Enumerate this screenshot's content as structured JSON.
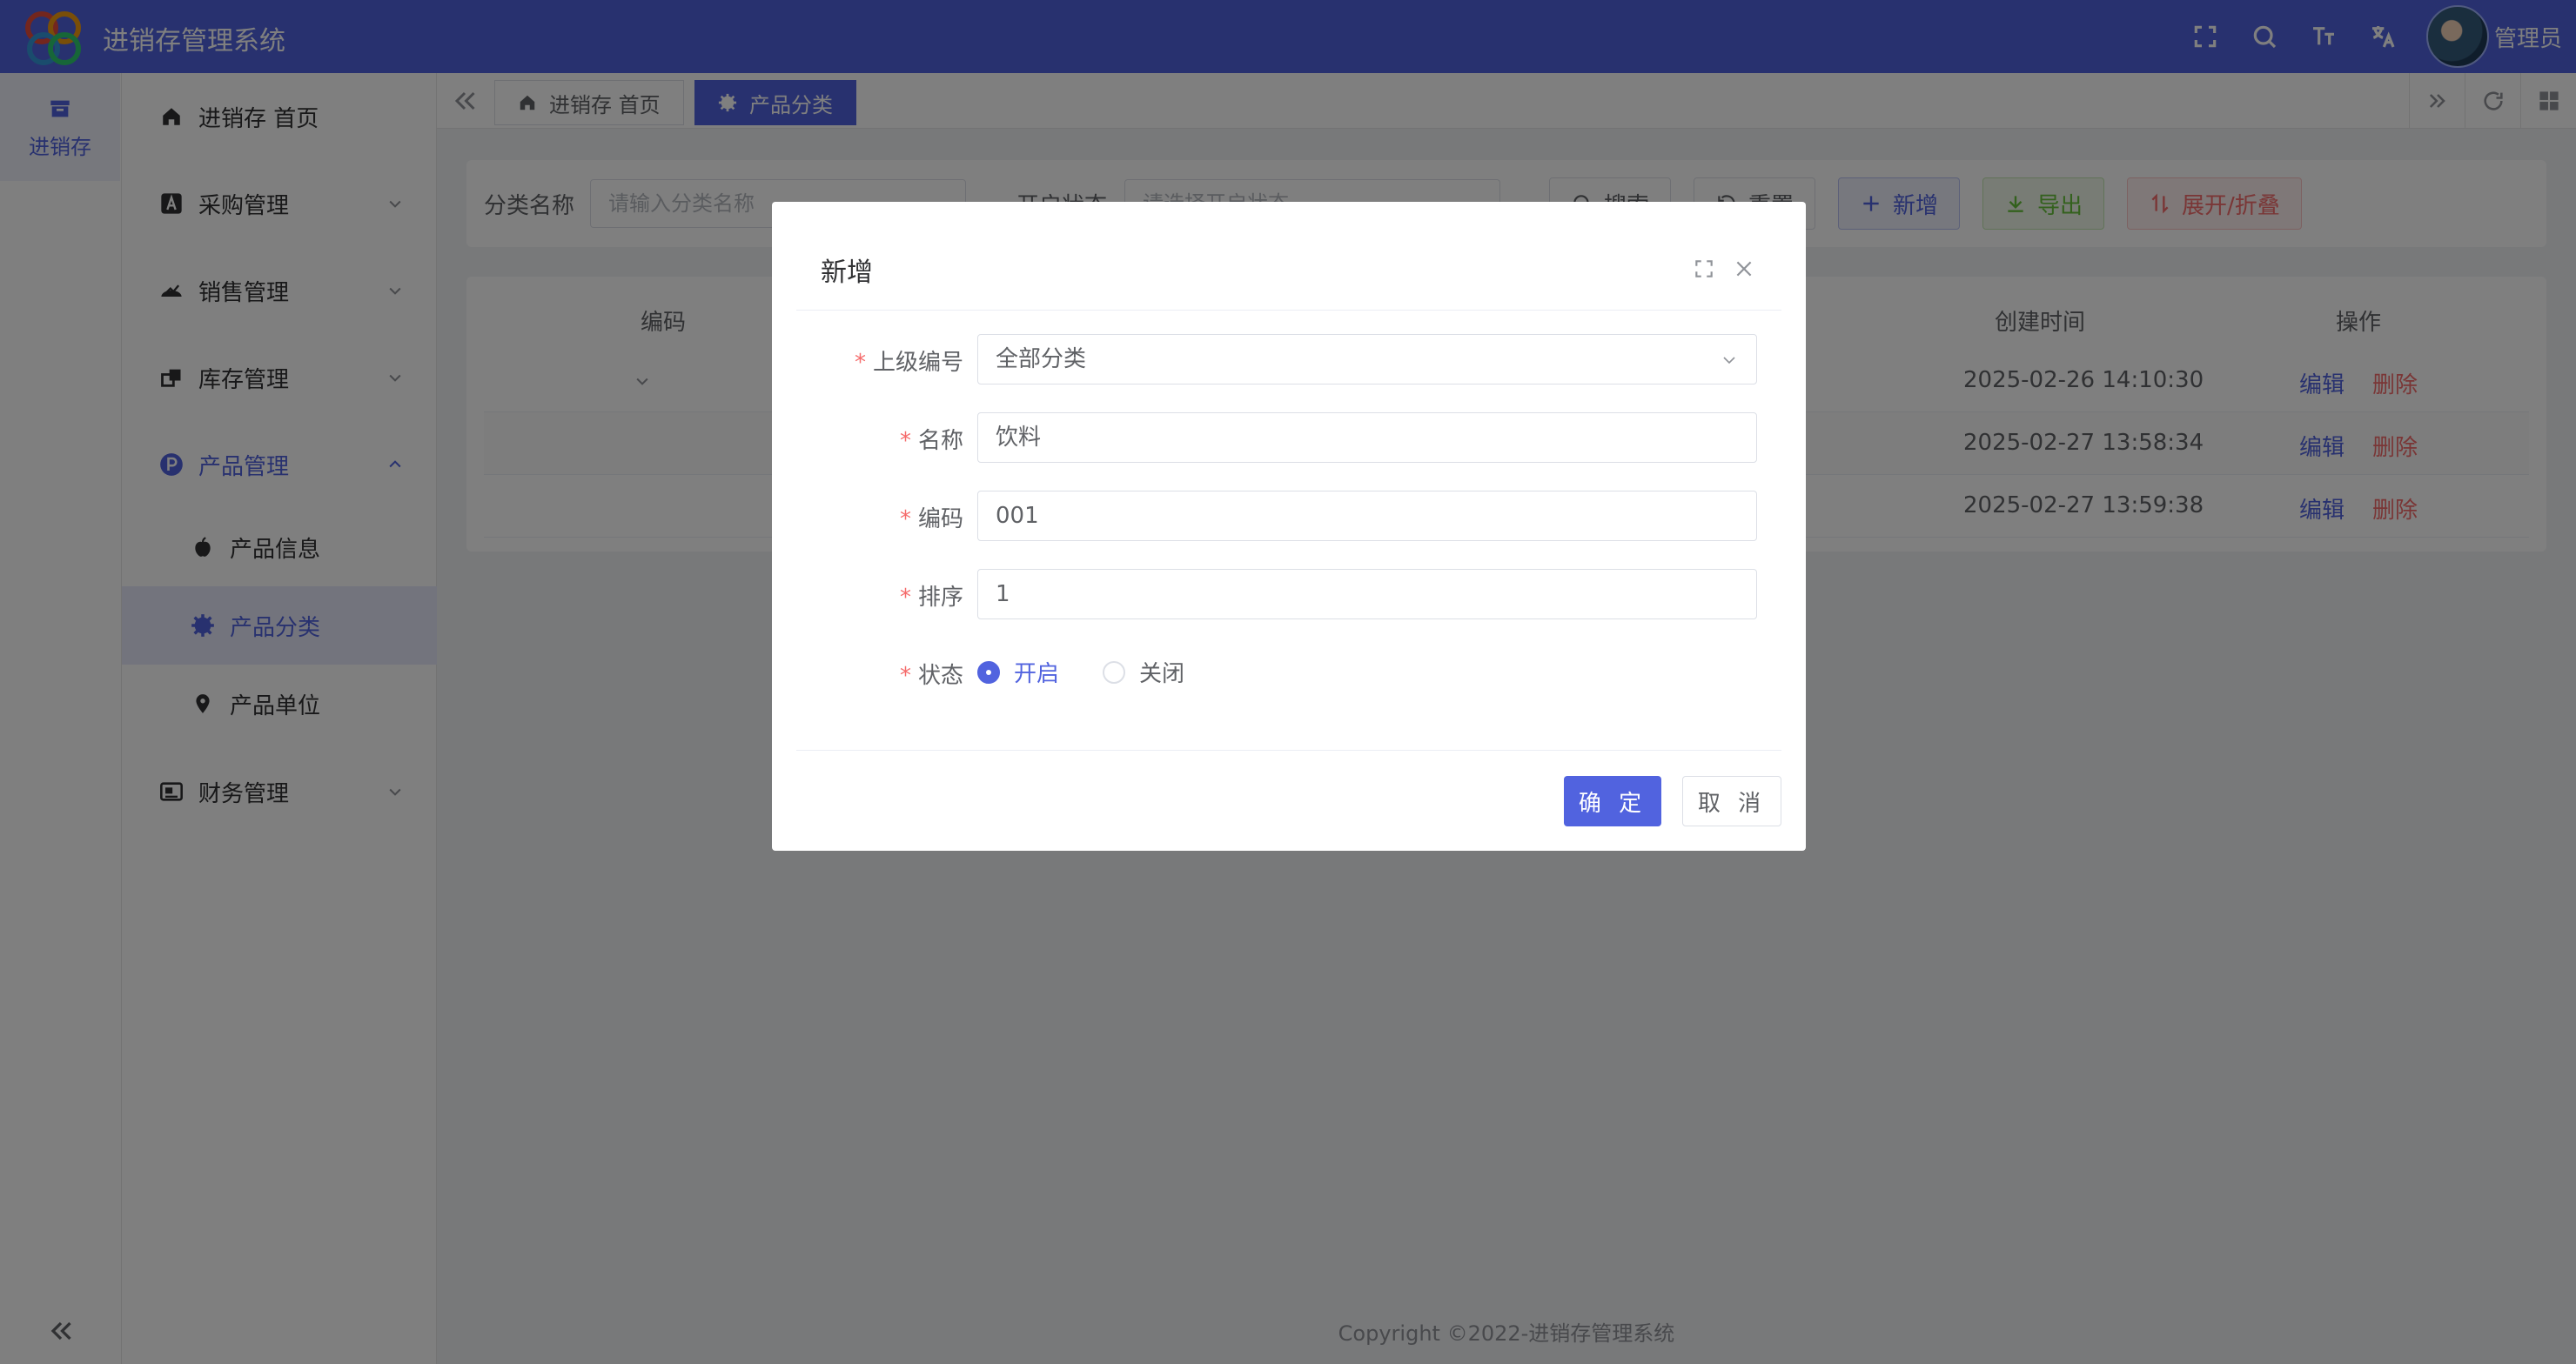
{
  "app": {
    "title": "进销存管理系统",
    "username": "管理员"
  },
  "colors": {
    "primary": "#5163df",
    "danger": "#f56c6c",
    "success": "#67c23a"
  },
  "rail": {
    "label": "进销存"
  },
  "sidebar": {
    "items": [
      {
        "label": "进销存 首页",
        "icon": "home-icon"
      },
      {
        "label": "采购管理",
        "icon": "purchase-icon"
      },
      {
        "label": "销售管理",
        "icon": "sales-icon"
      },
      {
        "label": "库存管理",
        "icon": "inventory-icon"
      },
      {
        "label": "产品管理",
        "icon": "product-icon"
      },
      {
        "label": "产品信息",
        "icon": "apple-icon"
      },
      {
        "label": "产品分类",
        "icon": "gear-icon"
      },
      {
        "label": "产品单位",
        "icon": "location-icon"
      },
      {
        "label": "财务管理",
        "icon": "finance-icon"
      }
    ]
  },
  "tabs": [
    {
      "label": "进销存 首页"
    },
    {
      "label": "产品分类"
    }
  ],
  "search": {
    "category_label": "分类名称",
    "category_placeholder": "请输入分类名称",
    "status_label": "开启状态",
    "status_placeholder": "请选择开启状态",
    "search_btn": "搜索",
    "reset_btn": "重置",
    "add_btn": "新增",
    "export_btn": "导出",
    "toggle_btn": "展开/折叠"
  },
  "table": {
    "headers": {
      "code": "编码",
      "created": "创建时间",
      "actions": "操作"
    },
    "rows": [
      {
        "created": "2025-02-26 14:10:30",
        "edit": "编辑",
        "delete": "删除"
      },
      {
        "created": "2025-02-27 13:58:34",
        "edit": "编辑",
        "delete": "删除"
      },
      {
        "created": "2025-02-27 13:59:38",
        "edit": "编辑",
        "delete": "删除"
      }
    ]
  },
  "footer": "Copyright ©2022-进销存管理系统",
  "dialog": {
    "title": "新增",
    "fields": {
      "parent": {
        "label": "上级编号",
        "value": "全部分类"
      },
      "name": {
        "label": "名称",
        "value": "饮料"
      },
      "code": {
        "label": "编码",
        "value": "001"
      },
      "sort": {
        "label": "排序",
        "value": "1"
      },
      "status": {
        "label": "状态",
        "options": [
          "开启",
          "关闭"
        ],
        "selected": "开启"
      }
    },
    "required_mark": "*",
    "confirm": "确 定",
    "cancel": "取 消"
  }
}
